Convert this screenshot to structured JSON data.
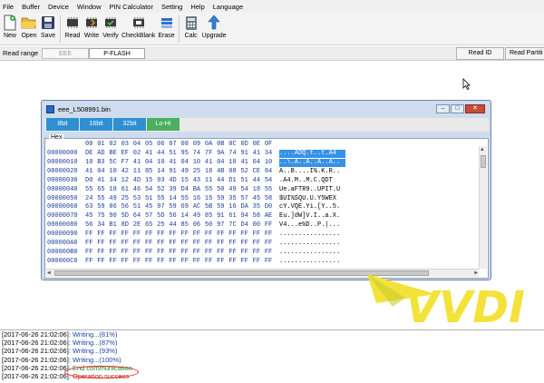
{
  "menu": [
    "File",
    "Buffer",
    "Device",
    "Window",
    "PIN Calculator",
    "Setting",
    "Help",
    "Language"
  ],
  "toolbar": {
    "buttons": [
      {
        "label": "New",
        "icon": "new-file-icon"
      },
      {
        "label": "Open",
        "icon": "open-folder-icon"
      },
      {
        "label": "Save",
        "icon": "save-icon"
      },
      {
        "label": "Read",
        "icon": "read-icon"
      },
      {
        "label": "Write",
        "icon": "write-icon"
      },
      {
        "label": "Verify",
        "icon": "verify-icon"
      },
      {
        "label": "CheckBlank",
        "icon": "check-blank-icon"
      },
      {
        "label": "Erase",
        "icon": "erase-icon"
      },
      {
        "label": "Calc",
        "icon": "calculator-icon"
      },
      {
        "label": "Upgrade",
        "icon": "upgrade-arrow-icon"
      }
    ]
  },
  "range": {
    "label": "Read range",
    "eee": "EEE",
    "pflash": "P-FLASH",
    "read_id": "Read ID",
    "read_partition": "Read Partiti"
  },
  "hex_window": {
    "title": "eee_L508991.bin",
    "tabs": [
      "8bit",
      "16bit",
      "32bit",
      "Lo-Hi"
    ],
    "group_label": "Hex",
    "column_headers": [
      "00",
      "01",
      "02",
      "03",
      "04",
      "05",
      "06",
      "07",
      "08",
      "09",
      "0A",
      "0B",
      "0C",
      "0D",
      "0E",
      "0F"
    ],
    "rows": [
      {
        "addr": "00000000",
        "bytes": [
          "DE",
          "AD",
          "BE",
          "EF",
          "02",
          "41",
          "44",
          "51",
          "95",
          "74",
          "7F",
          "9A",
          "74",
          "91",
          "41",
          "34"
        ],
        "ascii": "....ADQ.t..t.A4",
        "selected": true
      },
      {
        "addr": "00000010",
        "bytes": [
          "10",
          "B3",
          "5C",
          "F7",
          "41",
          "04",
          "10",
          "41",
          "04",
          "10",
          "41",
          "04",
          "10",
          "41",
          "04",
          "10"
        ],
        "ascii": "..\\.A..A..A..A..",
        "selected": true
      },
      {
        "addr": "00000020",
        "bytes": [
          "41",
          "04",
          "10",
          "42",
          "11",
          "85",
          "14",
          "91",
          "49",
          "25",
          "18",
          "4B",
          "08",
          "52",
          "CE",
          "84"
        ],
        "ascii": "A..B....I%.K.R..",
        "selected": false
      },
      {
        "addr": "00000030",
        "bytes": [
          "D0",
          "41",
          "34",
          "12",
          "4D",
          "15",
          "93",
          "4D",
          "15",
          "43",
          "11",
          "44",
          "D1",
          "51",
          "44",
          "54"
        ],
        "ascii": ".A4.M..M.C.QDT",
        "selected": false
      },
      {
        "addr": "00000040",
        "bytes": [
          "55",
          "65",
          "18",
          "61",
          "46",
          "54",
          "52",
          "39",
          "D4",
          "BA",
          "55",
          "50",
          "49",
          "54",
          "18",
          "55"
        ],
        "ascii": "Ue.aFTR9..UPIT.U",
        "selected": false
      },
      {
        "addr": "00000050",
        "bytes": [
          "24",
          "55",
          "49",
          "25",
          "53",
          "51",
          "55",
          "14",
          "55",
          "16",
          "15",
          "59",
          "35",
          "57",
          "45",
          "58"
        ],
        "ascii": "$UI%SQU.U.Y5WEX",
        "selected": false
      },
      {
        "addr": "00000060",
        "bytes": [
          "63",
          "59",
          "06",
          "56",
          "51",
          "45",
          "97",
          "59",
          "69",
          "AC",
          "5B",
          "59",
          "16",
          "DA",
          "35",
          "D0"
        ],
        "ascii": "cY.VQE.Yi.[Y..5.",
        "selected": false
      },
      {
        "addr": "00000070",
        "bytes": [
          "45",
          "75",
          "90",
          "5D",
          "64",
          "57",
          "5D",
          "56",
          "14",
          "49",
          "85",
          "91",
          "61",
          "94",
          "58",
          "AE"
        ],
        "ascii": "Eu.]dW]V.I..a.X.",
        "selected": false
      },
      {
        "addr": "00000080",
        "bytes": [
          "56",
          "34",
          "B1",
          "8D",
          "2E",
          "65",
          "25",
          "44",
          "85",
          "06",
          "50",
          "97",
          "7C",
          "D4",
          "00",
          "FF"
        ],
        "ascii": "V4...e%D..P.|...",
        "selected": false
      },
      {
        "addr": "00000090",
        "bytes": [
          "FF",
          "FF",
          "FF",
          "FF",
          "FF",
          "FF",
          "FF",
          "FF",
          "FF",
          "FF",
          "FF",
          "FF",
          "FF",
          "FF",
          "FF",
          "FF"
        ],
        "ascii": "................",
        "selected": false
      },
      {
        "addr": "000000A0",
        "bytes": [
          "FF",
          "FF",
          "FF",
          "FF",
          "FF",
          "FF",
          "FF",
          "FF",
          "FF",
          "FF",
          "FF",
          "FF",
          "FF",
          "FF",
          "FF",
          "FF"
        ],
        "ascii": "................",
        "selected": false
      },
      {
        "addr": "000000B0",
        "bytes": [
          "FF",
          "FF",
          "FF",
          "FF",
          "FF",
          "FF",
          "FF",
          "FF",
          "FF",
          "FF",
          "FF",
          "FF",
          "FF",
          "FF",
          "FF",
          "FF"
        ],
        "ascii": "................",
        "selected": false
      },
      {
        "addr": "000000C0",
        "bytes": [
          "FF",
          "FF",
          "FF",
          "FF",
          "FF",
          "FF",
          "FF",
          "FF",
          "FF",
          "FF",
          "FF",
          "FF",
          "FF",
          "FF",
          "FF",
          "FF"
        ],
        "ascii": "................",
        "selected": false
      }
    ]
  },
  "logo": {
    "text": "VVDI",
    "color": "#f2e23a"
  },
  "log": [
    {
      "ts": "[2017-06-26 21:02:06]",
      "msg": ": Writing...(81%)",
      "kind": "info"
    },
    {
      "ts": "[2017-06-26 21:02:06]",
      "msg": ": Writing...(87%)",
      "kind": "info"
    },
    {
      "ts": "[2017-06-26 21:02:06]",
      "msg": ": Writing...(93%)",
      "kind": "info"
    },
    {
      "ts": "[2017-06-26 21:02:06]",
      "msg": ": Writing...(100%)",
      "kind": "info"
    },
    {
      "ts": "[2017-06-26 21:02:06]",
      "msg": ": End communication",
      "kind": "green"
    },
    {
      "ts": "[2017-06-26 21:02:06]",
      "msg": ": Operation success",
      "kind": "red"
    }
  ],
  "colors": {
    "tab_blue": "#2f8fd3",
    "tab_green": "#4cae60",
    "selection": "#3592e8",
    "hex_text": "#1a3a9e"
  }
}
